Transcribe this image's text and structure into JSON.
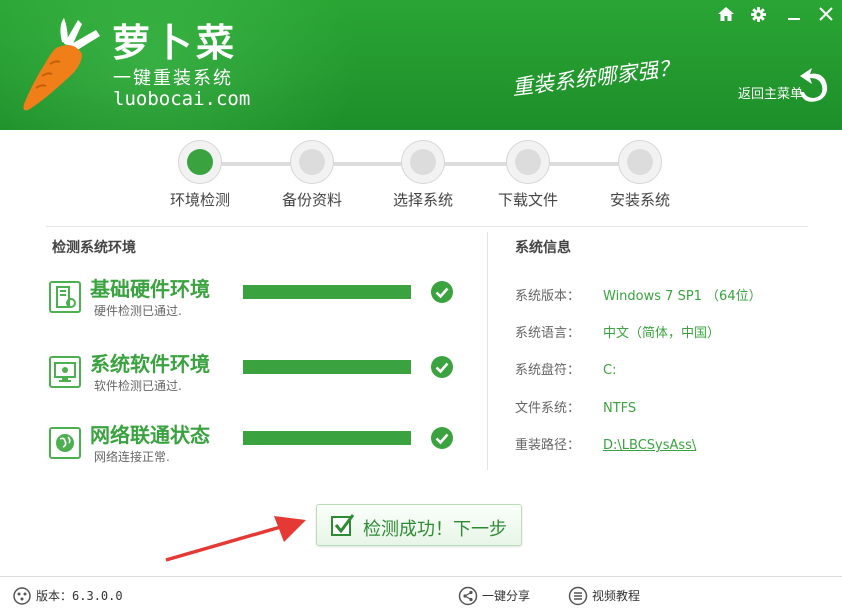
{
  "header": {
    "brand_name": "萝卜菜",
    "brand_sub": "一键重装系统",
    "brand_url": "luobocai.com",
    "slogan": "重装系统哪家强？",
    "back_home": "返回主菜单"
  },
  "window_controls": [
    "home-icon",
    "gear-icon",
    "minimize-icon",
    "close-icon"
  ],
  "steps": [
    {
      "label": "环境检测",
      "active": true
    },
    {
      "label": "备份资料",
      "active": false
    },
    {
      "label": "选择系统",
      "active": false
    },
    {
      "label": "下载文件",
      "active": false
    },
    {
      "label": "安装系统",
      "active": false
    }
  ],
  "checks": {
    "title": "检测系统环境",
    "items": [
      {
        "title": "基础硬件环境",
        "desc": "硬件检测已通过.",
        "progress": 1.0,
        "icon": "hardware-icon"
      },
      {
        "title": "系统软件环境",
        "desc": "软件检测已通过.",
        "progress": 1.0,
        "icon": "software-icon"
      },
      {
        "title": "网络联通状态",
        "desc": "网络连接正常.",
        "progress": 1.0,
        "icon": "network-icon"
      }
    ]
  },
  "system_info": {
    "title": "系统信息",
    "rows": [
      {
        "key": "系统版本：",
        "value": "Windows 7 SP1 （64位）"
      },
      {
        "key": "系统语言：",
        "value": "中文（简体，中国）"
      },
      {
        "key": "系统盘符：",
        "value": "C:"
      },
      {
        "key": "文件系统：",
        "value": "NTFS"
      },
      {
        "key": "重装路径：",
        "value": "D:\\LBCSysAss\\"
      }
    ]
  },
  "next_button": "检测成功！下一步",
  "footer": {
    "version_label": "版本：",
    "version_value": "6.3.0.0",
    "share": "一键分享",
    "tutorial": "视频教程"
  },
  "colors": {
    "brand_green": "#2aa534",
    "accent_green": "#3aa33f",
    "arrow_red": "#e53935",
    "carrot_orange": "#f07f1a"
  }
}
